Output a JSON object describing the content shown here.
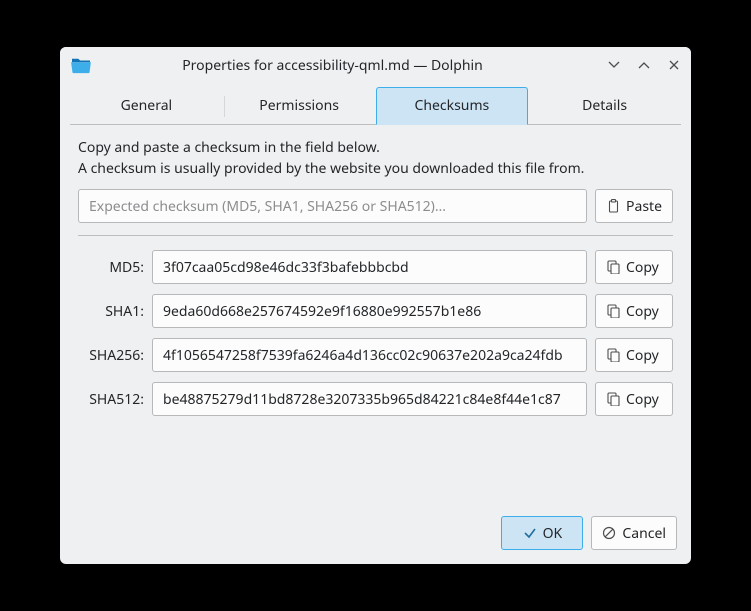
{
  "titlebar": {
    "title": "Properties for accessibility-qml.md — Dolphin"
  },
  "tabs": {
    "general": "General",
    "permissions": "Permissions",
    "checksums": "Checksums",
    "details": "Details"
  },
  "checksums": {
    "info_line1": "Copy and paste a checksum in the field below.",
    "info_line2": "A checksum is usually provided by the website you downloaded this file from.",
    "expected_placeholder": "Expected checksum (MD5, SHA1, SHA256 or SHA512)…",
    "paste_label": "Paste",
    "copy_label": "Copy",
    "rows": {
      "md5": {
        "label": "MD5:",
        "value": "3f07caa05cd98e46dc33f3bafebbbcbd"
      },
      "sha1": {
        "label": "SHA1:",
        "value": "9eda60d668e257674592e9f16880e992557b1e86"
      },
      "sha256": {
        "label": "SHA256:",
        "value": "4f1056547258f7539fa6246a4d136cc02c90637e202a9ca24fdb"
      },
      "sha512": {
        "label": "SHA512:",
        "value": "be48875279d11bd8728e3207335b965d84221c84e8f44e1c87"
      }
    }
  },
  "dialog": {
    "ok_label": "OK",
    "cancel_label": "Cancel"
  }
}
